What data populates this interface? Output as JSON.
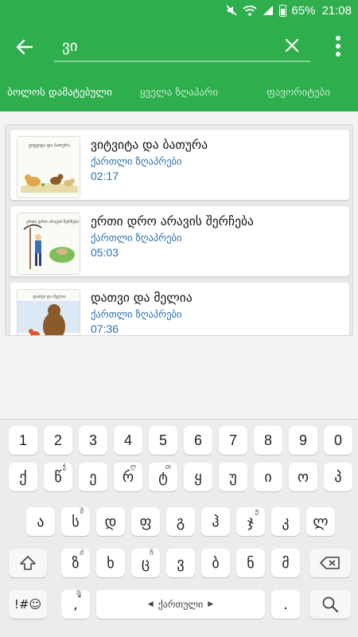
{
  "status_bar": {
    "battery": "65%",
    "time": "21:08"
  },
  "app_bar": {
    "search_value": "ვი",
    "icons": {
      "back": "arrow-back-icon",
      "clear": "close-icon",
      "more": "more-vert-icon"
    }
  },
  "tabs": [
    {
      "label": "ბოლოს დამატებული",
      "active": true
    },
    {
      "label": "ყველა ზღაპარი",
      "active": false
    },
    {
      "label": "ფავორიტები",
      "active": false
    }
  ],
  "results": [
    {
      "title": "ვიტვიტა და ბათურა",
      "category": "ქართლი ზღაპრები",
      "duration": "02:17",
      "thumb_caption": "ვიტვიტა და ბათურა"
    },
    {
      "title": "ერთი დრო არავის შერჩება",
      "category": "ქართლი ზღაპრები",
      "duration": "05:03",
      "thumb_caption": "ერთი დრო არავის შერჩება"
    },
    {
      "title": "დათვი და მელია",
      "category": "ქართლი ზღაპრები",
      "duration": "07:36",
      "thumb_caption": "დათვი და მელია"
    }
  ],
  "keyboard": {
    "row_numbers": [
      "1",
      "2",
      "3",
      "4",
      "5",
      "6",
      "7",
      "8",
      "9",
      "0"
    ],
    "row1": [
      {
        "c": "ქ",
        "h": ""
      },
      {
        "c": "წ",
        "h": "ჭ"
      },
      {
        "c": "ე",
        "h": ""
      },
      {
        "c": "რ",
        "h": "ღ"
      },
      {
        "c": "ტ",
        "h": "თ"
      },
      {
        "c": "ყ",
        "h": ""
      },
      {
        "c": "უ",
        "h": ""
      },
      {
        "c": "ი",
        "h": ""
      },
      {
        "c": "ო",
        "h": ""
      },
      {
        "c": "პ",
        "h": ""
      }
    ],
    "row2": [
      {
        "c": "ა",
        "h": ""
      },
      {
        "c": "ს",
        "h": "შ"
      },
      {
        "c": "დ",
        "h": ""
      },
      {
        "c": "ფ",
        "h": ""
      },
      {
        "c": "გ",
        "h": ""
      },
      {
        "c": "ჰ",
        "h": ""
      },
      {
        "c": "ჯ",
        "h": "ჟ"
      },
      {
        "c": "კ",
        "h": ""
      },
      {
        "c": "ლ",
        "h": ""
      }
    ],
    "row3": [
      {
        "c": "ზ",
        "h": "ძ"
      },
      {
        "c": "ხ",
        "h": ""
      },
      {
        "c": "ც",
        "h": "ჩ"
      },
      {
        "c": "ვ",
        "h": ""
      },
      {
        "c": "ბ",
        "h": ""
      },
      {
        "c": "ნ",
        "h": ""
      },
      {
        "c": "მ",
        "h": ""
      }
    ],
    "symbols_label": "!#☺",
    "comma": ",",
    "space_label": "ქართული",
    "period": ".",
    "icons": {
      "shift": "shift-icon",
      "backspace": "backspace-icon",
      "search": "search-icon"
    }
  },
  "colors": {
    "brand": "#2fae4e",
    "link": "#2a6fb0"
  }
}
